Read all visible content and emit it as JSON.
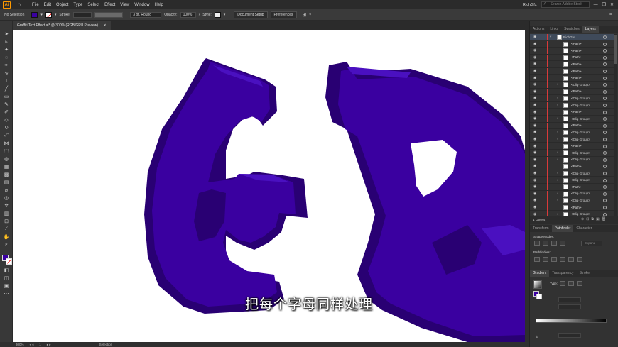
{
  "menubar": {
    "logo": "Ai",
    "menus": [
      "File",
      "Edit",
      "Object",
      "Type",
      "Select",
      "Effect",
      "View",
      "Window",
      "Help"
    ],
    "workspace": "RichGfx",
    "search_placeholder": "Search Adobe Stock"
  },
  "control": {
    "selection": "No Selection",
    "stroke_label": "Stroke:",
    "brush": "3 pt. Round",
    "opacity_label": "Opacity:",
    "opacity_value": "100%",
    "style_label": "Style:",
    "doc_setup": "Document Setup",
    "preferences": "Preferences"
  },
  "document": {
    "tab": "Graffiti Text Effect.ai* @ 300% (RGB/GPU Preview)"
  },
  "status": {
    "zoom": "300%",
    "page": "1",
    "tool": "Selection"
  },
  "subtitle": "把每个字母同样处理",
  "colors": {
    "letter_fill": "#3a00a0",
    "letter_shadow": "#290073",
    "letter_edge": "#4a10c0"
  },
  "layers_panel": {
    "tabs": [
      "Actions",
      "Links",
      "Swatches",
      "Layers"
    ],
    "layer_name": "RichGfx",
    "rows": [
      "<Path>",
      "<Path>",
      "<Path>",
      "<Path>",
      "<Path>",
      "<Path>",
      "<Clip Group>",
      "<Path>",
      "<Clip Group>",
      "<Clip Group>",
      "<Path>",
      "<Clip Group>",
      "<Path>",
      "<Clip Group>",
      "<Clip Group>",
      "<Path>",
      "<Clip Group>",
      "<Clip Group>",
      "<Path>",
      "<Clip Group>",
      "<Clip Group>",
      "<Path>",
      "<Clip Group>",
      "<Clip Group>",
      "<Path>",
      "<Clip Group>"
    ],
    "footer": "1 Layers"
  },
  "transform_panel": {
    "tabs": [
      "Transform",
      "Pathfinder",
      "Character"
    ],
    "shape_modes": "Shape Modes:",
    "pathfinders": "Pathfinders:",
    "expand": "Expand"
  },
  "gradient_panel": {
    "tabs": [
      "Gradient",
      "Transparency",
      "Stroke"
    ],
    "type_label": "Type:"
  }
}
